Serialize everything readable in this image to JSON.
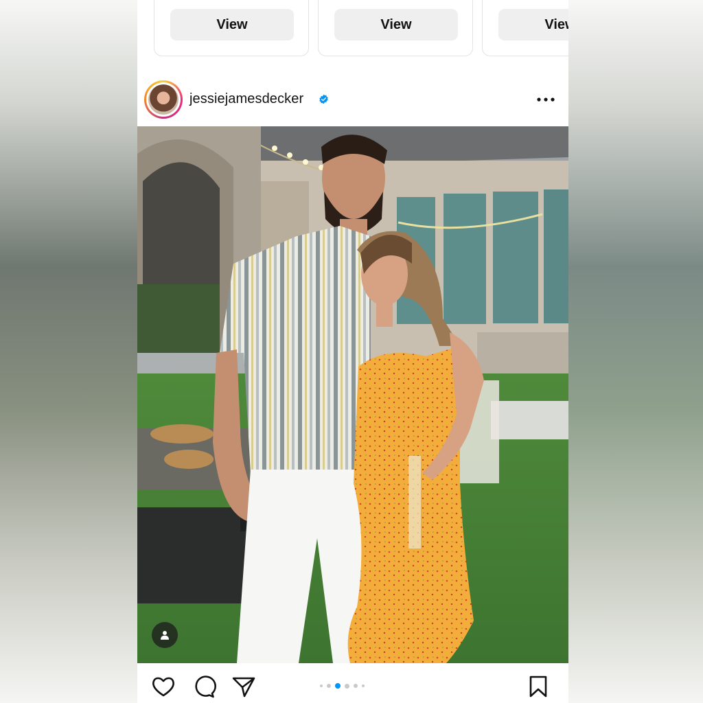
{
  "suggestions": {
    "cards": [
      {
        "button_label": "View"
      },
      {
        "button_label": "View"
      },
      {
        "button_label": "View"
      }
    ]
  },
  "post": {
    "username": "jessiejamesdecker",
    "verified": true,
    "more_icon": "more-horizontal-icon",
    "carousel": {
      "total": 6,
      "active_index": 2
    }
  },
  "actions": {
    "like_icon": "heart-icon",
    "comment_icon": "comment-icon",
    "share_icon": "share-icon",
    "save_icon": "bookmark-icon",
    "tag_icon": "user-tag-icon"
  },
  "colors": {
    "accent_blue": "#0095f6",
    "button_bg": "#efefef",
    "text": "#111111"
  }
}
